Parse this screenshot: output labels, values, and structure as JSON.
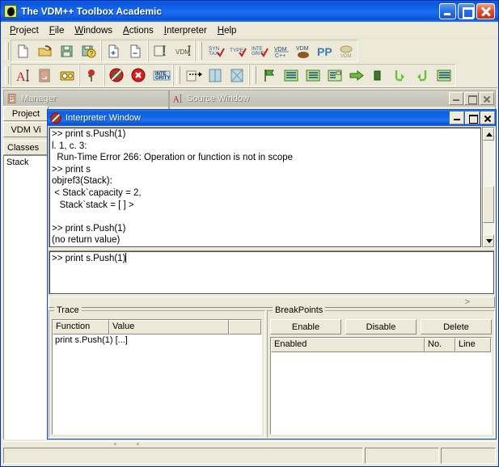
{
  "window": {
    "title": "The VDM++ Toolbox Academic",
    "icon": "vdm-leaf-icon",
    "buttons": {
      "minimize": "minimize",
      "maximize": "maximize",
      "close": "close"
    }
  },
  "menubar": {
    "items": [
      {
        "label": "Project",
        "mnemonic": "P"
      },
      {
        "label": "File",
        "mnemonic": "F"
      },
      {
        "label": "Windows",
        "mnemonic": "W"
      },
      {
        "label": "Actions",
        "mnemonic": "A"
      },
      {
        "label": "Interpreter",
        "mnemonic": "I"
      },
      {
        "label": "Help",
        "mnemonic": "H"
      }
    ]
  },
  "toolbars": {
    "row1": [
      {
        "name": "new-project-icon",
        "label": "New Project"
      },
      {
        "name": "open-project-icon",
        "label": "Open Project"
      },
      {
        "name": "save-project-icon",
        "label": "Save Project"
      },
      {
        "name": "save-project-as-icon",
        "label": "Save Project As"
      },
      {
        "name": "add-file-icon",
        "label": "Add File"
      },
      {
        "name": "remove-file-icon",
        "label": "Remove File"
      },
      {
        "name": "new-source-window-icon",
        "label": "New Source Window"
      },
      {
        "name": "vdm-tool-icon",
        "label": "VDM Tool"
      },
      {
        "name": "syntax-check-icon",
        "label": "SYN TAX"
      },
      {
        "name": "type-check-icon",
        "label": "TYPE"
      },
      {
        "name": "integrity-check-icon",
        "label": "INTE GRITY"
      },
      {
        "name": "vdm-to-cpp-icon",
        "label": "VDM C++"
      },
      {
        "name": "vdm-java-icon",
        "label": "VDM"
      },
      {
        "name": "pretty-print-icon",
        "label": "PP"
      },
      {
        "name": "vdm-doc-icon",
        "label": "VDM"
      }
    ],
    "row2": [
      {
        "name": "text-format-icon",
        "label": "A"
      },
      {
        "name": "clipboard-icon",
        "label": "Clipboard"
      },
      {
        "name": "camera-icon",
        "label": "Camera"
      },
      {
        "name": "rose-icon",
        "label": "Rose Link"
      },
      {
        "name": "no-entry-icon",
        "label": "Stop Interpreter"
      },
      {
        "name": "abort-icon",
        "label": "Abort"
      },
      {
        "name": "integrity-icon",
        "label": "INTE GRITY"
      },
      {
        "name": "debug-arrow-icon",
        "label": "Debug"
      },
      {
        "name": "window-blue-1-icon",
        "label": "Window"
      },
      {
        "name": "window-blue-2-icon",
        "label": "Window"
      },
      {
        "name": "flag-icon",
        "label": "Start Debugging"
      },
      {
        "name": "list-1-icon",
        "label": "List"
      },
      {
        "name": "list-2-icon",
        "label": "List"
      },
      {
        "name": "list-3-icon",
        "label": "List"
      },
      {
        "name": "step-in-icon",
        "label": "Step In"
      },
      {
        "name": "step-block-icon",
        "label": "Stop"
      },
      {
        "name": "step-over-icon",
        "label": "Step Over"
      },
      {
        "name": "step-out-icon",
        "label": "Step Out"
      },
      {
        "name": "list-4-icon",
        "label": "Continue"
      }
    ]
  },
  "mdi": {
    "manager_window": {
      "title": "Manager",
      "icon": "clipboard-icon",
      "active": false
    },
    "source_window": {
      "title": "Source Window",
      "icon": "font-a-icon",
      "active": false,
      "buttons": {
        "minimize": "minimize",
        "maximize": "maximize",
        "close": "close"
      }
    },
    "interpreter_window": {
      "title": "Interpreter Window",
      "icon": "no-entry-icon",
      "active": true,
      "buttons": {
        "minimize": "minimize",
        "maximize": "maximize",
        "close": "close"
      }
    }
  },
  "project_panel": {
    "tabs": [
      {
        "label": "Project",
        "selected": true
      },
      {
        "label": "VDM Vi",
        "selected": false
      }
    ],
    "classes_header": "Classes",
    "classes": [
      "Stack"
    ]
  },
  "interpreter": {
    "output_lines": [
      ">> print s.Push(1)",
      "l. 1, c. 3:",
      "  Run-Time Error 266: Operation or function is not in scope",
      ">> print s",
      "objref3(Stack):",
      " < Stack`capacity = 2,",
      "   Stack`stack = [ ] >",
      "",
      ">> print s.Push(1)",
      "(no return value)"
    ],
    "command_input": {
      "value": ">> print s.Push(1)",
      "placeholder": ""
    },
    "splitter_glyph": ">"
  },
  "trace_panel": {
    "legend": "Trace",
    "columns": [
      "Function",
      "Value",
      ""
    ],
    "rows": [
      {
        "function": "print s.Push(1)",
        "value": "[...]"
      }
    ]
  },
  "breakpoints_panel": {
    "legend": "BreakPoints",
    "buttons": [
      "Enable",
      "Disable",
      "Delete"
    ],
    "columns": [
      "Enabled",
      "No.",
      "Line"
    ],
    "rows": []
  },
  "statusbar": {
    "main": "",
    "pane2": "",
    "pane3": ""
  },
  "colors": {
    "titlebar_blue": "#0f62e8",
    "face": "#ece9d8",
    "shadow": "#8d8a7e",
    "close_red": "#e4502a",
    "text": "#000000"
  }
}
